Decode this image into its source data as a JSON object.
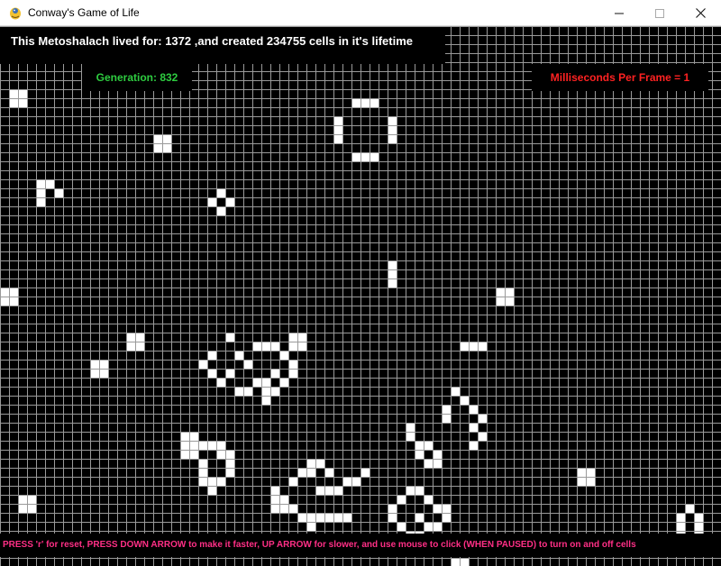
{
  "window": {
    "title": "Conway's Game of Life",
    "icon": "pygame-snake-icon",
    "controls": {
      "minimize": "─",
      "maximize": "☐",
      "close": "✕"
    }
  },
  "hud": {
    "lifetime": "This Metoshalach lived for: 1372 ,and created 234755 cells in it's lifetime",
    "generation": "Generation: 832",
    "speed": "Milliseconds Per Frame = 1",
    "help": "PRESS 'r' for reset, PRESS DOWN ARROW to make it faster, UP ARROW for slower, and use mouse to click (WHEN PAUSED) to turn on and off cells"
  },
  "colors": {
    "grid_background": "#000000",
    "grid_lines": "#9a9a9a",
    "live_cell": "#ffffff",
    "generation_text": "#2ecc40",
    "speed_text": "#ff2222",
    "help_text": "#ff2f86"
  },
  "grid": {
    "columns": 80,
    "rows": 60,
    "live_cells": [
      [
        1,
        7
      ],
      [
        2,
        7
      ],
      [
        1,
        8
      ],
      [
        2,
        8
      ],
      [
        17,
        12
      ],
      [
        18,
        12
      ],
      [
        17,
        13
      ],
      [
        18,
        13
      ],
      [
        4,
        17
      ],
      [
        5,
        17
      ],
      [
        4,
        18
      ],
      [
        6,
        18
      ],
      [
        4,
        19
      ],
      [
        24,
        18
      ],
      [
        23,
        19
      ],
      [
        25,
        19
      ],
      [
        24,
        20
      ],
      [
        39,
        8
      ],
      [
        40,
        8
      ],
      [
        41,
        8
      ],
      [
        37,
        10
      ],
      [
        37,
        11
      ],
      [
        37,
        12
      ],
      [
        43,
        10
      ],
      [
        43,
        11
      ],
      [
        43,
        12
      ],
      [
        39,
        14
      ],
      [
        40,
        14
      ],
      [
        41,
        14
      ],
      [
        43,
        26
      ],
      [
        43,
        27
      ],
      [
        43,
        28
      ],
      [
        0,
        29
      ],
      [
        1,
        29
      ],
      [
        0,
        30
      ],
      [
        1,
        30
      ],
      [
        55,
        29
      ],
      [
        56,
        29
      ],
      [
        55,
        30
      ],
      [
        56,
        30
      ],
      [
        14,
        34
      ],
      [
        15,
        34
      ],
      [
        14,
        35
      ],
      [
        15,
        35
      ],
      [
        32,
        34
      ],
      [
        33,
        34
      ],
      [
        32,
        35
      ],
      [
        33,
        35
      ],
      [
        51,
        35
      ],
      [
        52,
        35
      ],
      [
        53,
        35
      ],
      [
        10,
        37
      ],
      [
        11,
        37
      ],
      [
        10,
        38
      ],
      [
        11,
        38
      ],
      [
        25,
        34
      ],
      [
        28,
        35
      ],
      [
        29,
        35
      ],
      [
        30,
        35
      ],
      [
        23,
        36
      ],
      [
        26,
        36
      ],
      [
        31,
        36
      ],
      [
        22,
        37
      ],
      [
        27,
        37
      ],
      [
        32,
        37
      ],
      [
        23,
        38
      ],
      [
        25,
        38
      ],
      [
        30,
        38
      ],
      [
        32,
        38
      ],
      [
        24,
        39
      ],
      [
        28,
        39
      ],
      [
        29,
        39
      ],
      [
        31,
        39
      ],
      [
        26,
        40
      ],
      [
        27,
        40
      ],
      [
        29,
        40
      ],
      [
        30,
        40
      ],
      [
        29,
        41
      ],
      [
        50,
        40
      ],
      [
        51,
        41
      ],
      [
        49,
        42
      ],
      [
        52,
        42
      ],
      [
        49,
        43
      ],
      [
        53,
        43
      ],
      [
        52,
        44
      ],
      [
        53,
        45
      ],
      [
        52,
        46
      ],
      [
        45,
        44
      ],
      [
        45,
        45
      ],
      [
        46,
        46
      ],
      [
        47,
        46
      ],
      [
        46,
        47
      ],
      [
        48,
        47
      ],
      [
        47,
        48
      ],
      [
        48,
        48
      ],
      [
        20,
        45
      ],
      [
        21,
        45
      ],
      [
        20,
        46
      ],
      [
        21,
        46
      ],
      [
        22,
        46
      ],
      [
        23,
        46
      ],
      [
        24,
        46
      ],
      [
        20,
        47
      ],
      [
        21,
        47
      ],
      [
        24,
        47
      ],
      [
        25,
        47
      ],
      [
        22,
        48
      ],
      [
        25,
        48
      ],
      [
        22,
        49
      ],
      [
        25,
        49
      ],
      [
        22,
        50
      ],
      [
        23,
        50
      ],
      [
        24,
        50
      ],
      [
        23,
        51
      ],
      [
        34,
        48
      ],
      [
        35,
        48
      ],
      [
        33,
        49
      ],
      [
        34,
        49
      ],
      [
        36,
        49
      ],
      [
        40,
        49
      ],
      [
        32,
        50
      ],
      [
        38,
        50
      ],
      [
        39,
        50
      ],
      [
        30,
        51
      ],
      [
        35,
        51
      ],
      [
        36,
        51
      ],
      [
        37,
        51
      ],
      [
        30,
        52
      ],
      [
        31,
        52
      ],
      [
        30,
        53
      ],
      [
        31,
        53
      ],
      [
        32,
        53
      ],
      [
        33,
        54
      ],
      [
        34,
        54
      ],
      [
        35,
        54
      ],
      [
        36,
        54
      ],
      [
        37,
        54
      ],
      [
        38,
        54
      ],
      [
        34,
        55
      ],
      [
        45,
        51
      ],
      [
        46,
        51
      ],
      [
        44,
        52
      ],
      [
        47,
        52
      ],
      [
        43,
        53
      ],
      [
        48,
        53
      ],
      [
        49,
        53
      ],
      [
        43,
        54
      ],
      [
        46,
        54
      ],
      [
        49,
        54
      ],
      [
        44,
        55
      ],
      [
        47,
        55
      ],
      [
        48,
        55
      ],
      [
        45,
        56
      ],
      [
        46,
        56
      ],
      [
        2,
        52
      ],
      [
        3,
        52
      ],
      [
        2,
        53
      ],
      [
        3,
        53
      ],
      [
        64,
        49
      ],
      [
        65,
        49
      ],
      [
        64,
        50
      ],
      [
        65,
        50
      ],
      [
        76,
        53
      ],
      [
        75,
        54
      ],
      [
        77,
        54
      ],
      [
        75,
        55
      ],
      [
        77,
        55
      ],
      [
        75,
        56
      ],
      [
        77,
        56
      ],
      [
        50,
        59
      ],
      [
        51,
        59
      ]
    ]
  }
}
